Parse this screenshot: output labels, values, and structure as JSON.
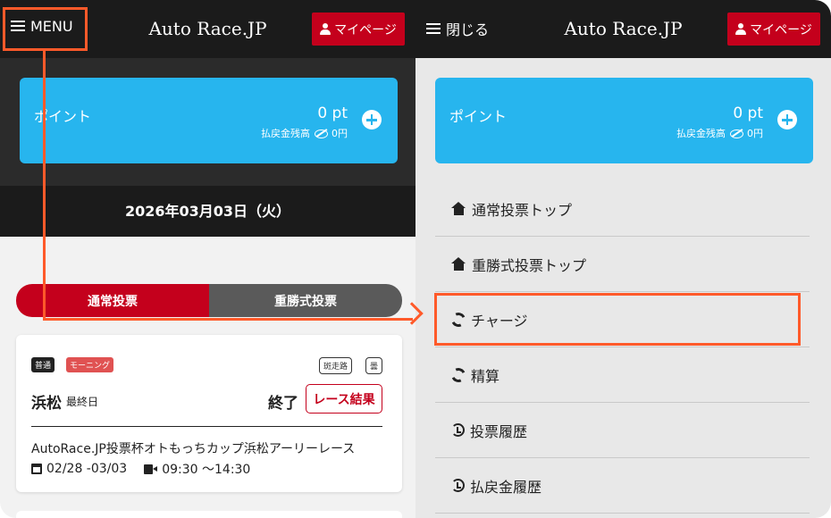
{
  "left": {
    "header": {
      "menu_label": "MENU",
      "logo": "Auto Race.JP",
      "mypage_label": "マイページ"
    },
    "points": {
      "label": "ポイント",
      "value": "0 pt",
      "sub_label": "払戻金残高",
      "sub_value": "0円"
    },
    "date": "2026年03月03日（火）",
    "tabs": [
      {
        "label": "通常投票"
      },
      {
        "label": "重勝式投票"
      }
    ],
    "race": {
      "badges": [
        "普通",
        "モーニング",
        "斑走路",
        "曇"
      ],
      "venue": "浜松",
      "venue_sub": "最終日",
      "status": "終了",
      "result_button": "レース結果",
      "title": "AutoRace.JP投票杯オトもっちカップ浜松アーリーレース",
      "dates": "02/28 -03/03",
      "times": "09:30 ～14:30"
    }
  },
  "right": {
    "header": {
      "close_label": "閉じる",
      "logo": "Auto Race.JP",
      "mypage_label": "マイページ"
    },
    "points": {
      "label": "ポイント",
      "value": "0 pt",
      "sub_label": "払戻金残高",
      "sub_value": "0円"
    },
    "menu": [
      {
        "label": "通常投票トップ",
        "icon": "home-icon"
      },
      {
        "label": "重勝式投票トップ",
        "icon": "home-icon"
      },
      {
        "label": "チャージ",
        "icon": "sync-icon"
      },
      {
        "label": "精算",
        "icon": "sync-icon"
      },
      {
        "label": "投票履歴",
        "icon": "history-icon"
      },
      {
        "label": "払戻金履歴",
        "icon": "history-icon"
      }
    ]
  },
  "colors": {
    "brand_red": "#c4001c",
    "point_blue": "#27b5ee",
    "highlight": "#ff5a2a",
    "header_dark": "#1b1b1b"
  }
}
